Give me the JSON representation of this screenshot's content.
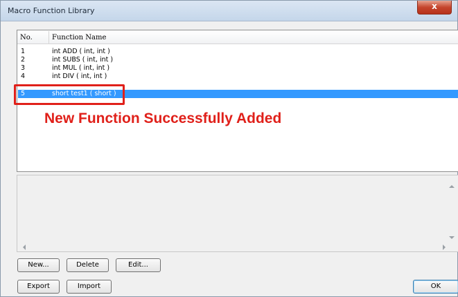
{
  "window": {
    "title": "Macro Function Library",
    "close_label": "x"
  },
  "list": {
    "headers": {
      "no": "No.",
      "name": "Function Name"
    },
    "rows": [
      {
        "no": "1",
        "name": "int ADD ( int, int )",
        "selected": false
      },
      {
        "no": "2",
        "name": "int SUBS ( int, int )",
        "selected": false
      },
      {
        "no": "3",
        "name": "int MUL ( int, int )",
        "selected": false
      },
      {
        "no": "4",
        "name": "int DIV ( int, int )",
        "selected": false
      },
      {
        "no": "5",
        "name": "short test1 ( short )",
        "selected": true
      }
    ]
  },
  "annotation": {
    "text": "New Function Successfully Added",
    "color": "#e0201a"
  },
  "buttons": {
    "new": "New...",
    "delete": "Delete",
    "edit": "Edit...",
    "export": "Export",
    "import": "Import",
    "ok": "OK"
  },
  "colors": {
    "selection": "#3399ff",
    "annotation": "#e0201a"
  }
}
